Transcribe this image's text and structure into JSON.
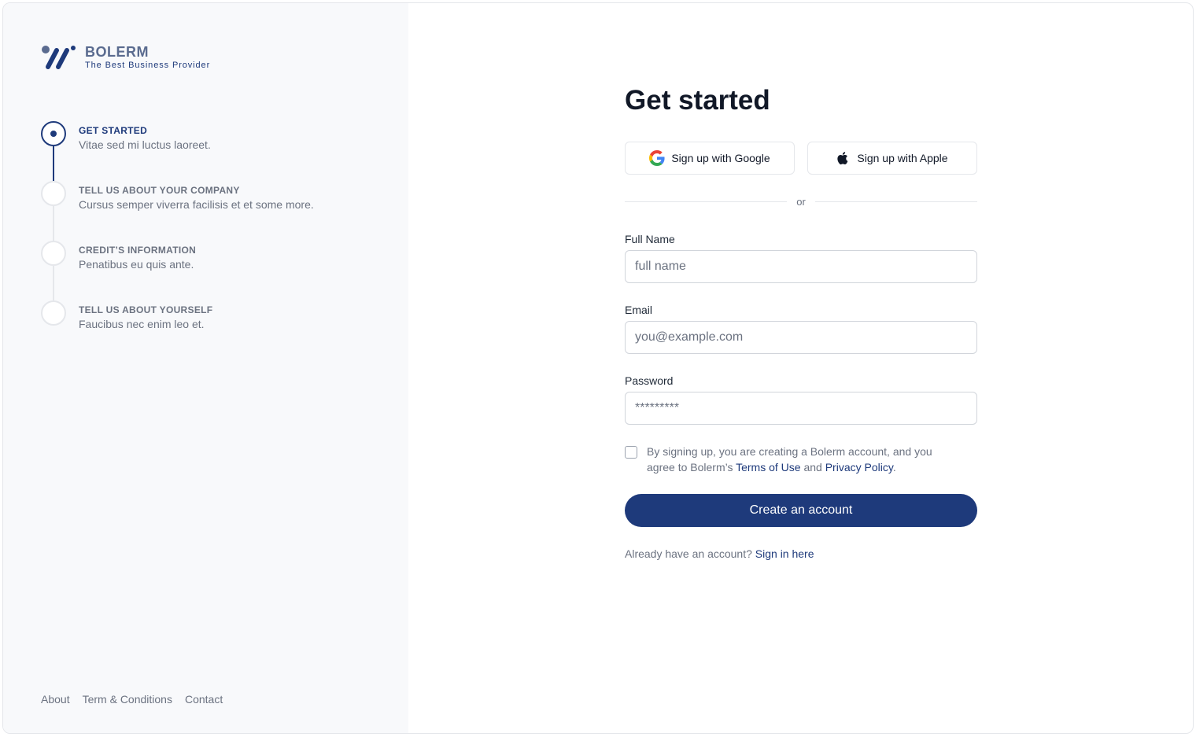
{
  "brand": {
    "name": "BOLERM",
    "tagline": "The Best Business Provider",
    "colors": {
      "primary": "#1e3a7b",
      "logo_text": "#5a6b8f",
      "sidebar_bg": "#f8f9fb"
    }
  },
  "steps": [
    {
      "title": "GET STARTED",
      "description": "Vitae sed mi luctus laoreet.",
      "active": true
    },
    {
      "title": "TELL US ABOUT YOUR COMPANY",
      "description": "Cursus semper viverra facilisis et et some more.",
      "active": false
    },
    {
      "title": "CREDIT’S INFORMATION",
      "description": "Penatibus eu quis ante.",
      "active": false
    },
    {
      "title": "TELL US ABOUT YOURSELF",
      "description": "Faucibus nec enim leo et.",
      "active": false
    }
  ],
  "footer": {
    "about": "About",
    "terms": "Term & Conditions",
    "contact": "Contact"
  },
  "form": {
    "title": "Get started",
    "google_label": "Sign up with Google",
    "apple_label": "Sign up with Apple",
    "divider_text": "or",
    "full_name": {
      "label": "Full Name",
      "placeholder": "full name",
      "value": ""
    },
    "email": {
      "label": "Email",
      "placeholder": "you@example.com",
      "value": ""
    },
    "password": {
      "label": "Password",
      "placeholder": "*********",
      "value": ""
    },
    "terms": {
      "prefix": "By signing up, you are creating a Bolerm account, and you agree to Bolerm’s ",
      "terms_link": "Terms of Use",
      "and": " and ",
      "privacy_link": "Privacy Policy",
      "suffix": ".",
      "checked": false
    },
    "submit_label": "Create an account",
    "signin_prompt": "Already have an account? ",
    "signin_link": "Sign in here"
  }
}
